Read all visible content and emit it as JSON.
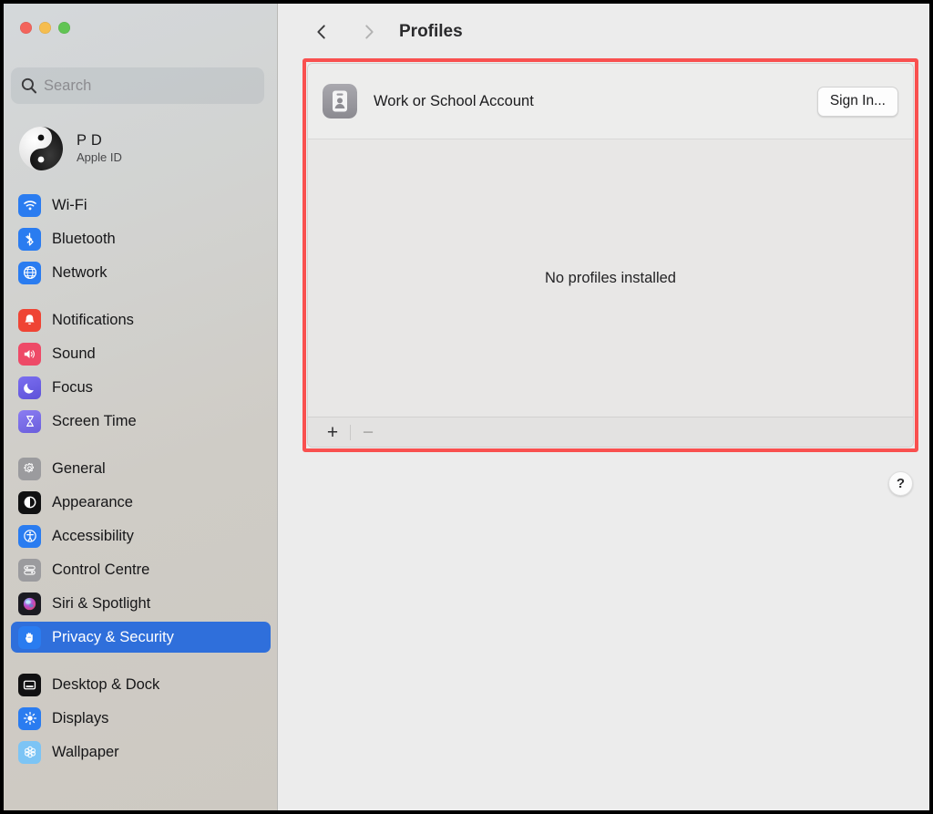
{
  "window": {
    "traffic_lights": [
      {
        "name": "close",
        "color": "#f3645c"
      },
      {
        "name": "minimize",
        "color": "#f5bd4f"
      },
      {
        "name": "zoom",
        "color": "#61c454"
      }
    ]
  },
  "sidebar": {
    "search": {
      "placeholder": "Search",
      "value": ""
    },
    "account": {
      "name": "P D",
      "subtitle": "Apple ID",
      "avatar": "yin-yang-avatar"
    },
    "groups": [
      {
        "items": [
          {
            "label": "Wi-Fi",
            "icon": "wifi-icon",
            "selected": false
          },
          {
            "label": "Bluetooth",
            "icon": "bluetooth-icon",
            "selected": false
          },
          {
            "label": "Network",
            "icon": "network-globe-icon",
            "selected": false
          }
        ]
      },
      {
        "items": [
          {
            "label": "Notifications",
            "icon": "bell-icon",
            "selected": false
          },
          {
            "label": "Sound",
            "icon": "speaker-icon",
            "selected": false
          },
          {
            "label": "Focus",
            "icon": "moon-icon",
            "selected": false
          },
          {
            "label": "Screen Time",
            "icon": "hourglass-icon",
            "selected": false
          }
        ]
      },
      {
        "items": [
          {
            "label": "General",
            "icon": "gear-icon",
            "selected": false
          },
          {
            "label": "Appearance",
            "icon": "appearance-circle-icon",
            "selected": false
          },
          {
            "label": "Accessibility",
            "icon": "accessibility-icon",
            "selected": false
          },
          {
            "label": "Control Centre",
            "icon": "control-centre-icon",
            "selected": false
          },
          {
            "label": "Siri & Spotlight",
            "icon": "siri-orb-icon",
            "selected": false
          },
          {
            "label": "Privacy & Security",
            "icon": "hand-icon",
            "selected": true
          }
        ]
      },
      {
        "items": [
          {
            "label": "Desktop & Dock",
            "icon": "desktop-dock-icon",
            "selected": false
          },
          {
            "label": "Displays",
            "icon": "brightness-icon",
            "selected": false
          },
          {
            "label": "Wallpaper",
            "icon": "wallpaper-flower-icon",
            "selected": false
          }
        ]
      }
    ]
  },
  "main": {
    "toolbar": {
      "back_icon": "chevron-left-icon",
      "forward_icon": "chevron-right-icon",
      "title": "Profiles"
    },
    "card": {
      "header": {
        "icon": "id-badge-icon",
        "label": "Work or School Account",
        "sign_in_label": "Sign In..."
      },
      "empty_state": "No profiles installed",
      "footer": {
        "add_label": "+",
        "remove_label": "−"
      }
    },
    "help_label": "?",
    "annotation_color": "#f9504f"
  }
}
